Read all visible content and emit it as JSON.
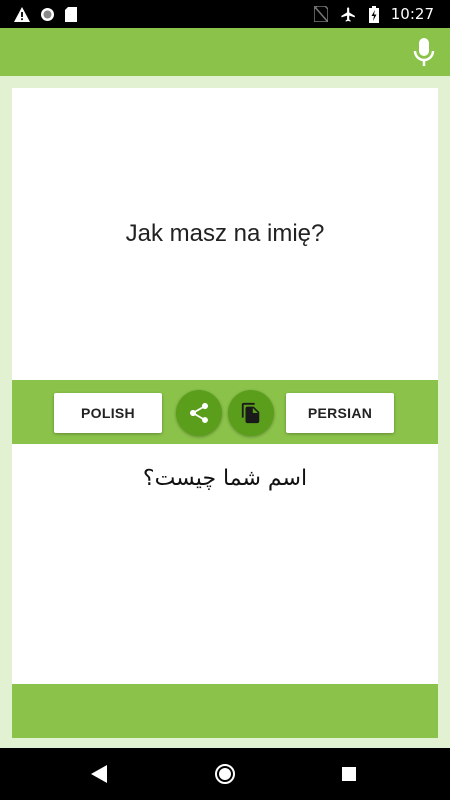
{
  "status_bar": {
    "time": "10:27"
  },
  "source": {
    "text": "Jak masz na imię?"
  },
  "controls": {
    "source_language": "POLISH",
    "target_language": "PERSIAN"
  },
  "target": {
    "text": "اسم شما چیست؟"
  },
  "colors": {
    "accent": "#8bc34a",
    "accent_dark": "#5a9e1c",
    "background": "#e3f1d3"
  },
  "icons": {
    "toolbar": [
      "microphone-icon"
    ],
    "controls": [
      "share-icon",
      "copy-icon"
    ],
    "navigation": [
      "back-icon",
      "home-icon",
      "recents-icon"
    ]
  }
}
